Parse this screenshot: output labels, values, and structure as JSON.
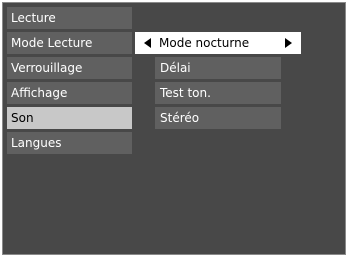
{
  "menu": {
    "items": [
      {
        "label": "Lecture"
      },
      {
        "label": "Mode Lecture"
      },
      {
        "label": "Verrouillage"
      },
      {
        "label": "Affichage"
      },
      {
        "label": "Son"
      },
      {
        "label": "Langues"
      }
    ],
    "selected": "Son"
  },
  "submenu": {
    "selected_label": "Mode nocturne",
    "items": [
      {
        "label": "Délai"
      },
      {
        "label": "Test ton."
      },
      {
        "label": "Stéréo"
      }
    ]
  },
  "icons": {
    "left": "triangle-left-icon",
    "right": "triangle-right-icon"
  }
}
